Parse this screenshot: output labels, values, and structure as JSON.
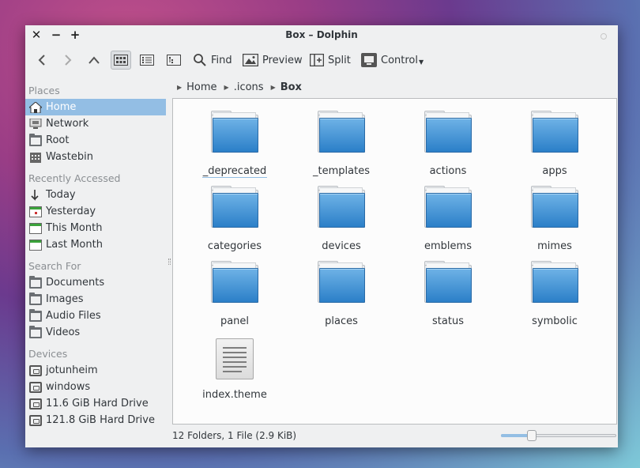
{
  "window": {
    "title": "Box – Dolphin"
  },
  "toolbar": {
    "find_label": "Find",
    "preview_label": "Preview",
    "split_label": "Split",
    "control_label": "Control"
  },
  "sidebar": {
    "places_title": "Places",
    "places": [
      {
        "label": "Home",
        "icon": "home-icon"
      },
      {
        "label": "Network",
        "icon": "network-icon"
      },
      {
        "label": "Root",
        "icon": "folder-icon"
      },
      {
        "label": "Wastebin",
        "icon": "trash-icon"
      }
    ],
    "recent_title": "Recently Accessed",
    "recent": [
      {
        "label": "Today",
        "icon": "today-icon"
      },
      {
        "label": "Yesterday",
        "icon": "calendar-icon"
      },
      {
        "label": "This Month",
        "icon": "calendar-icon"
      },
      {
        "label": "Last Month",
        "icon": "calendar-icon"
      }
    ],
    "search_title": "Search For",
    "search": [
      {
        "label": "Documents",
        "icon": "folder-icon"
      },
      {
        "label": "Images",
        "icon": "folder-icon"
      },
      {
        "label": "Audio Files",
        "icon": "folder-icon"
      },
      {
        "label": "Videos",
        "icon": "folder-icon"
      }
    ],
    "devices_title": "Devices",
    "devices": [
      {
        "label": "jotunheim",
        "icon": "drive-icon"
      },
      {
        "label": "windows",
        "icon": "drive-icon"
      },
      {
        "label": "11.6 GiB Hard Drive",
        "icon": "drive-icon"
      },
      {
        "label": "121.8 GiB Hard Drive",
        "icon": "drive-icon"
      }
    ]
  },
  "breadcrumb": [
    "Home",
    ".icons",
    "Box"
  ],
  "items": [
    {
      "name": "_deprecated",
      "type": "folder"
    },
    {
      "name": "_templates",
      "type": "folder"
    },
    {
      "name": "actions",
      "type": "folder"
    },
    {
      "name": "apps",
      "type": "folder"
    },
    {
      "name": "categories",
      "type": "folder"
    },
    {
      "name": "devices",
      "type": "folder"
    },
    {
      "name": "emblems",
      "type": "folder"
    },
    {
      "name": "mimes",
      "type": "folder"
    },
    {
      "name": "panel",
      "type": "folder"
    },
    {
      "name": "places",
      "type": "folder"
    },
    {
      "name": "status",
      "type": "folder"
    },
    {
      "name": "symbolic",
      "type": "folder"
    },
    {
      "name": "index.theme",
      "type": "file"
    }
  ],
  "status": {
    "summary": "12 Folders, 1 File (2.9 KiB)",
    "zoom_fraction": 0.27
  },
  "colors": {
    "selection": "#93bee4",
    "folder_blue": "#2b7fc8"
  }
}
